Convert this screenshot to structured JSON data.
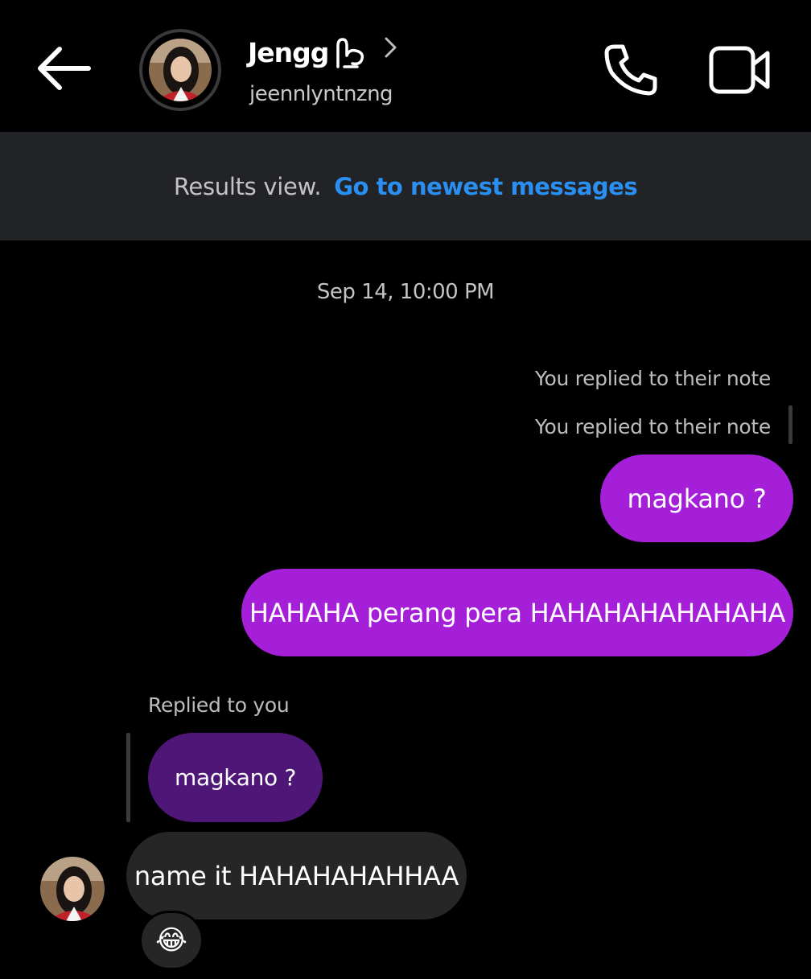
{
  "header": {
    "name": "Jengg",
    "username": "jeennlyntnzng",
    "icons": {
      "back": "arrow-left-icon",
      "call": "phone-icon",
      "video": "video-camera-icon",
      "name_emoji": "hand-doodle-icon",
      "chevron": "chevron-right-icon"
    }
  },
  "banner": {
    "text": "Results view.",
    "link": "Go to newest messages"
  },
  "conversation": {
    "date": "Sep 14, 10:00 PM",
    "note_reply_1": "You replied to their note",
    "note_reply_2": "You replied to their note",
    "sent_1": "magkano ?",
    "sent_2": "HAHAHA perang pera HAHAHAHAHAHAHA",
    "replied_label": "Replied to you",
    "quoted": "magkano ?",
    "received": "name it HAHAHAHAHHAA",
    "reaction": "😂"
  },
  "colors": {
    "sent_bubble": "#a51fd9",
    "quoted_bubble": "#4e1676",
    "received_bubble": "#262626",
    "banner_bg": "#222327",
    "link": "#2a8ff0"
  }
}
